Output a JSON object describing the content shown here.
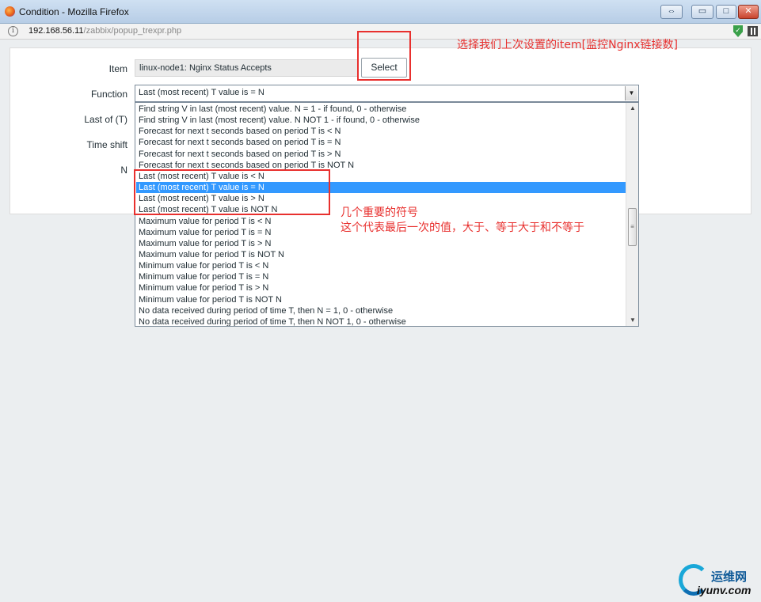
{
  "window": {
    "title": "Condition - Mozilla Firefox",
    "buttons": {
      "restore": "⇔",
      "minimize": "▭",
      "maximize": "□",
      "close": "✕"
    }
  },
  "address_bar": {
    "host": "192.168.56.11",
    "path": "/zabbix/popup_trexpr.php",
    "info_icon": "i",
    "shield_icon": "✓"
  },
  "form": {
    "item_label": "Item",
    "item_value": "linux-node1: Nginx Status Accepts",
    "select_button": "Select",
    "function_label": "Function",
    "function_value": "Last (most recent) T value is = N",
    "last_of_label": "Last of (T)",
    "time_shift_label": "Time shift",
    "n_label": "N"
  },
  "dropdown": {
    "options": [
      "Find string V in last (most recent) value. N = 1 - if found, 0 - otherwise",
      "Find string V in last (most recent) value. N NOT 1 - if found, 0 - otherwise",
      "Forecast for next t seconds based on period T is < N",
      "Forecast for next t seconds based on period T is = N",
      "Forecast for next t seconds based on period T is > N",
      "Forecast for next t seconds based on period T is NOT N",
      "Last (most recent) T value is < N",
      "Last (most recent) T value is = N",
      "Last (most recent) T value is > N",
      "Last (most recent) T value is NOT N",
      "Maximum value for period T is < N",
      "Maximum value for period T is = N",
      "Maximum value for period T is > N",
      "Maximum value for period T is NOT N",
      "Minimum value for period T is < N",
      "Minimum value for period T is = N",
      "Minimum value for period T is > N",
      "Minimum value for period T is NOT N",
      "No data received during period of time T, then N = 1, 0 - otherwise",
      "No data received during period of time T, then N NOT 1, 0 - otherwise"
    ],
    "selected_index": 7,
    "scroll_up": "▲",
    "scroll_down": "▼",
    "thumb_grip": "≡"
  },
  "annotations": {
    "select_note": "选择我们上次设置的item[监控Nginx链接数]",
    "symbols_note_line1": "几个重要的符号",
    "symbols_note_line2": "这个代表最后一次的值，大于、等于大于和不等于",
    "color": "#e8302e"
  },
  "watermark": {
    "cn": "运维网",
    "en": "iyunv.com"
  }
}
